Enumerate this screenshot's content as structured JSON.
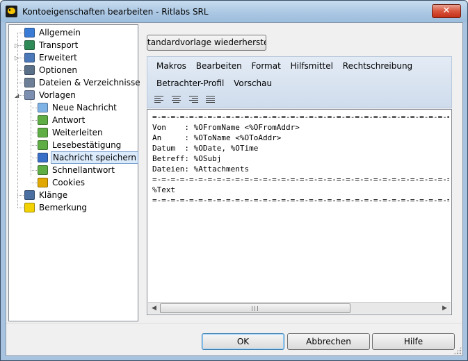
{
  "window": {
    "title": "Kontoeigenschaften bearbeiten - Ritlabs SRL",
    "close_label": "✕"
  },
  "tree": {
    "items": [
      {
        "label": "Allgemein",
        "icon": "person-icon",
        "color": "#3a7bd5",
        "expander": ""
      },
      {
        "label": "Transport",
        "icon": "network-icon",
        "color": "#2e8b57",
        "expander": "▷"
      },
      {
        "label": "Erweitert",
        "icon": "settings-icon",
        "color": "#4a78b8",
        "expander": "▷"
      },
      {
        "label": "Optionen",
        "icon": "options-icon",
        "color": "#5a6f88",
        "expander": ""
      },
      {
        "label": "Dateien & Verzeichnisse",
        "icon": "files-icon",
        "color": "#6c7f96",
        "expander": ""
      },
      {
        "label": "Vorlagen",
        "icon": "templates-icon",
        "color": "#7c8fb0",
        "expander": "◢"
      },
      {
        "label": "Neue Nachricht",
        "icon": "new-message-icon",
        "color": "#7fb3e6"
      },
      {
        "label": "Antwort",
        "icon": "reply-icon",
        "color": "#5fae45"
      },
      {
        "label": "Weiterleiten",
        "icon": "forward-icon",
        "color": "#5fae45"
      },
      {
        "label": "Lesebestätigung",
        "icon": "receipt-icon",
        "color": "#5fae45"
      },
      {
        "label": "Nachricht speichern",
        "icon": "save-message-icon",
        "color": "#3a6fc8"
      },
      {
        "label": "Schnellantwort",
        "icon": "quick-reply-icon",
        "color": "#5fae45"
      },
      {
        "label": "Cookies",
        "icon": "cookies-icon",
        "color": "#e0a800"
      },
      {
        "label": "Klänge",
        "icon": "sound-icon",
        "color": "#4a6fa0"
      },
      {
        "label": "Bemerkung",
        "icon": "note-icon",
        "color": "#f2d200"
      }
    ]
  },
  "template": {
    "restore_label": "tandardvorlage wiederherstellen",
    "menu": [
      "Makros",
      "Bearbeiten",
      "Format",
      "Hilfsmittel",
      "Rechtschreibung"
    ],
    "menu2": [
      "Betrachter-Profil",
      "Vorschau"
    ],
    "editor_text": "=-=-=-=-=-=-=-=-=-=-=-=-=-=-=-=-=-=-=-=-=-=-=-=-=-=-=-=-=-=-=-=-=-=-=-=-=-=-=-=-=-=-=-=-=\nVon    : %OFromName <%OFromAddr>\nAn     : %OToName <%OToAddr>\nDatum  : %ODate, %OTime\nBetreff: %OSubj\nDateien: %Attachments\n=-=-=-=-=-=-=-=-=-=-=-=-=-=-=-=-=-=-=-=-=-=-=-=-=-=-=-=-=-=-=-=-=-=-=-=-=-=-=-=-=-=-=-=-=\n%Text\n=-=-=-=-=-=-=-=-=-=-=-=-=-=-=-=-=-=-=-=-=-=-=-=-=-=-=-=-=-=-=-=-=-=-=-=-=-=-=-=-=-=-=-=-="
  },
  "buttons": {
    "ok": "OK",
    "cancel": "Abbrechen",
    "help": "Hilfe"
  }
}
